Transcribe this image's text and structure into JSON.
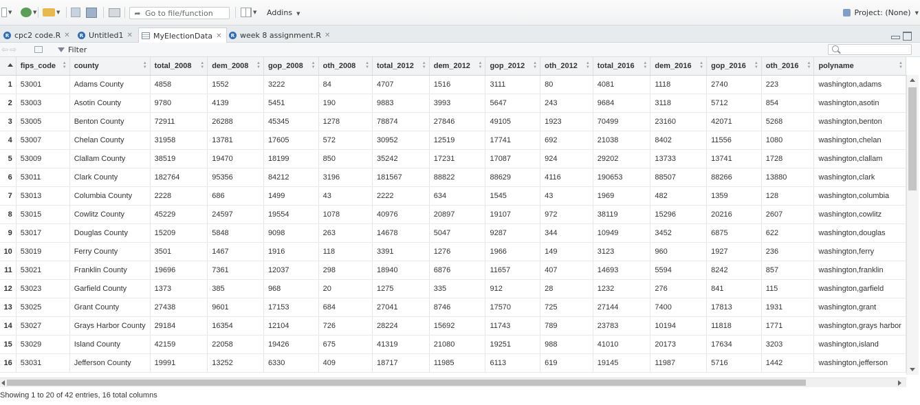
{
  "toolbar": {
    "goto_placeholder": "Go to file/function",
    "addins_label": "Addins",
    "project_label": "Project: (None)"
  },
  "tabs": [
    {
      "label": "cpc2 code.R"
    },
    {
      "label": "Untitled1"
    },
    {
      "label": "MyElectionData"
    },
    {
      "label": "week 8 assignment.R"
    }
  ],
  "filterbar": {
    "filter_label": "Filter"
  },
  "table": {
    "columns": [
      "fips_code",
      "county",
      "total_2008",
      "dem_2008",
      "gop_2008",
      "oth_2008",
      "total_2012",
      "dem_2012",
      "gop_2012",
      "oth_2012",
      "total_2016",
      "dem_2016",
      "gop_2016",
      "oth_2016",
      "polyname"
    ],
    "rows": [
      [
        "1",
        "53001",
        "Adams County",
        "4858",
        "1552",
        "3222",
        "84",
        "4707",
        "1516",
        "3111",
        "80",
        "4081",
        "1118",
        "2740",
        "223",
        "washington,adams"
      ],
      [
        "2",
        "53003",
        "Asotin County",
        "9780",
        "4139",
        "5451",
        "190",
        "9883",
        "3993",
        "5647",
        "243",
        "9684",
        "3118",
        "5712",
        "854",
        "washington,asotin"
      ],
      [
        "3",
        "53005",
        "Benton County",
        "72911",
        "26288",
        "45345",
        "1278",
        "78874",
        "27846",
        "49105",
        "1923",
        "70499",
        "23160",
        "42071",
        "5268",
        "washington,benton"
      ],
      [
        "4",
        "53007",
        "Chelan County",
        "31958",
        "13781",
        "17605",
        "572",
        "30952",
        "12519",
        "17741",
        "692",
        "21038",
        "8402",
        "11556",
        "1080",
        "washington,chelan"
      ],
      [
        "5",
        "53009",
        "Clallam County",
        "38519",
        "19470",
        "18199",
        "850",
        "35242",
        "17231",
        "17087",
        "924",
        "29202",
        "13733",
        "13741",
        "1728",
        "washington,clallam"
      ],
      [
        "6",
        "53011",
        "Clark County",
        "182764",
        "95356",
        "84212",
        "3196",
        "181567",
        "88822",
        "88629",
        "4116",
        "190653",
        "88507",
        "88266",
        "13880",
        "washington,clark"
      ],
      [
        "7",
        "53013",
        "Columbia County",
        "2228",
        "686",
        "1499",
        "43",
        "2222",
        "634",
        "1545",
        "43",
        "1969",
        "482",
        "1359",
        "128",
        "washington,columbia"
      ],
      [
        "8",
        "53015",
        "Cowlitz County",
        "45229",
        "24597",
        "19554",
        "1078",
        "40976",
        "20897",
        "19107",
        "972",
        "38119",
        "15296",
        "20216",
        "2607",
        "washington,cowlitz"
      ],
      [
        "9",
        "53017",
        "Douglas County",
        "15209",
        "5848",
        "9098",
        "263",
        "14678",
        "5047",
        "9287",
        "344",
        "10949",
        "3452",
        "6875",
        "622",
        "washington,douglas"
      ],
      [
        "10",
        "53019",
        "Ferry County",
        "3501",
        "1467",
        "1916",
        "118",
        "3391",
        "1276",
        "1966",
        "149",
        "3123",
        "960",
        "1927",
        "236",
        "washington,ferry"
      ],
      [
        "11",
        "53021",
        "Franklin County",
        "19696",
        "7361",
        "12037",
        "298",
        "18940",
        "6876",
        "11657",
        "407",
        "14693",
        "5594",
        "8242",
        "857",
        "washington,franklin"
      ],
      [
        "12",
        "53023",
        "Garfield County",
        "1373",
        "385",
        "968",
        "20",
        "1275",
        "335",
        "912",
        "28",
        "1232",
        "276",
        "841",
        "115",
        "washington,garfield"
      ],
      [
        "13",
        "53025",
        "Grant County",
        "27438",
        "9601",
        "17153",
        "684",
        "27041",
        "8746",
        "17570",
        "725",
        "27144",
        "7400",
        "17813",
        "1931",
        "washington,grant"
      ],
      [
        "14",
        "53027",
        "Grays Harbor County",
        "29184",
        "16354",
        "12104",
        "726",
        "28224",
        "15692",
        "11743",
        "789",
        "23783",
        "10194",
        "11818",
        "1771",
        "washington,grays harbor"
      ],
      [
        "15",
        "53029",
        "Island County",
        "42159",
        "22058",
        "19426",
        "675",
        "41319",
        "21080",
        "19251",
        "988",
        "41010",
        "20173",
        "17634",
        "3203",
        "washington,island"
      ],
      [
        "16",
        "53031",
        "Jefferson County",
        "19991",
        "13252",
        "6330",
        "409",
        "18717",
        "11985",
        "6113",
        "619",
        "19145",
        "11987",
        "5716",
        "1442",
        "washington,jefferson"
      ]
    ]
  },
  "status_text": "Showing 1 to 20 of 42 entries, 16 total columns"
}
